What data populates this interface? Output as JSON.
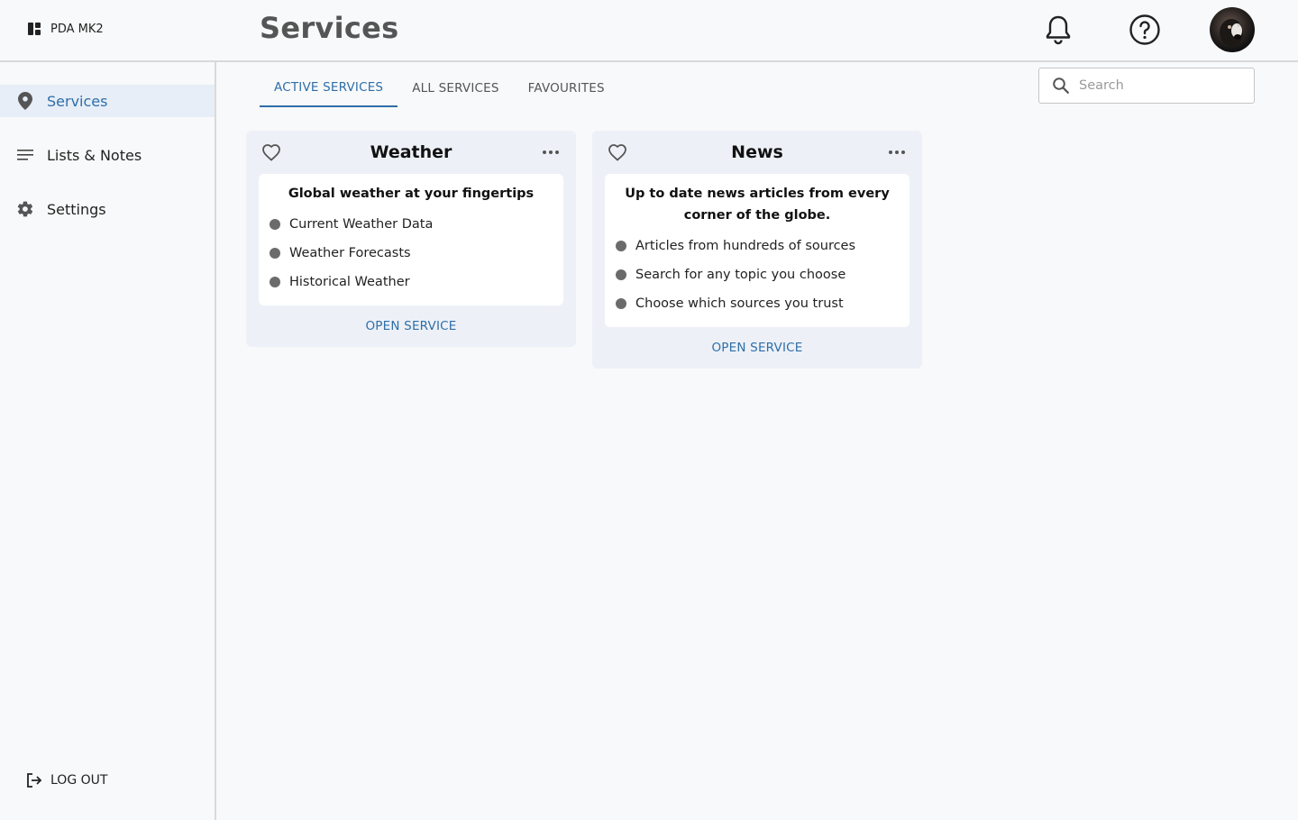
{
  "brand": {
    "name": "PDA MK2"
  },
  "header": {
    "title": "Services"
  },
  "sidebar": {
    "items": [
      {
        "label": "Services",
        "icon": "location-pin-icon",
        "active": true
      },
      {
        "label": "Lists & Notes",
        "icon": "lines-icon",
        "active": false
      },
      {
        "label": "Settings",
        "icon": "gear-icon",
        "active": false
      }
    ],
    "logout_label": "LOG OUT"
  },
  "tabs": [
    {
      "label": "ACTIVE SERVICES",
      "active": true
    },
    {
      "label": "ALL SERVICES",
      "active": false
    },
    {
      "label": "FAVOURITES",
      "active": false
    }
  ],
  "search": {
    "placeholder": "Search",
    "value": ""
  },
  "cards": [
    {
      "title": "Weather",
      "heading": "Global weather at your fingertips",
      "features": [
        "Current Weather Data",
        "Weather Forecasts",
        "Historical Weather"
      ],
      "action": "OPEN SERVICE"
    },
    {
      "title": "News",
      "heading": "Up to date news articles from every corner of the globe.",
      "features": [
        "Articles from hundreds of sources",
        "Search for any topic you choose",
        "Choose which sources you trust"
      ],
      "action": "OPEN SERVICE"
    }
  ],
  "colors": {
    "accent": "#2f6ea8",
    "active_bg": "#e7eef7",
    "card_bg": "#edf1f7",
    "page_bg": "#f8f9fa"
  }
}
